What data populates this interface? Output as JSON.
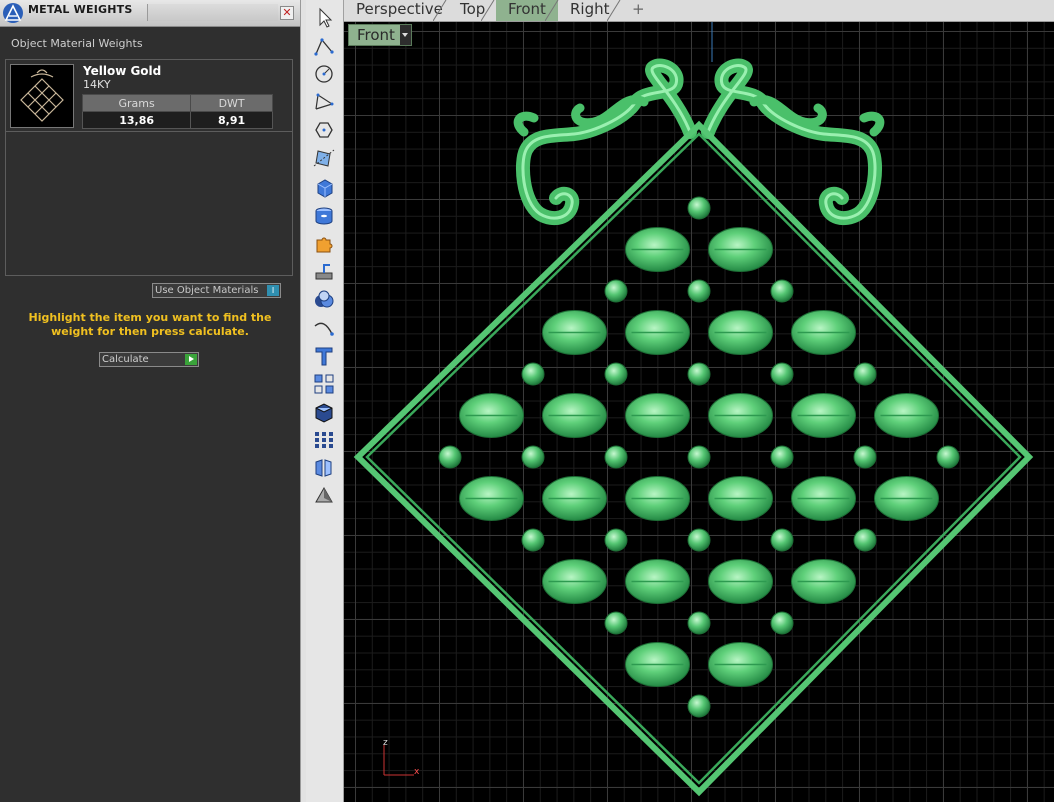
{
  "panel": {
    "title": "METAL WEIGHTS",
    "close_glyph": "✕",
    "section_title": "Object Material Weights",
    "material": {
      "name": "Yellow Gold",
      "karat": "14KY",
      "columns": [
        "Grams",
        "DWT"
      ],
      "values": [
        "13,86",
        "8,91"
      ]
    },
    "use_object_materials": {
      "label": "Use Object Materials",
      "toggle_glyph": "I"
    },
    "instructions": "Highlight the item you want to find the weight for then press calculate.",
    "calculate_label": "Calculate"
  },
  "toolbar": {
    "icons": [
      "select-arrow-icon",
      "polyline-icon",
      "circle-icon",
      "curve-icon",
      "polygon-icon",
      "transform-icon",
      "box-icon",
      "cylinder-icon",
      "puzzle-icon",
      "extrude-icon",
      "boolean-icon",
      "rail-curve-icon",
      "text-tool-icon",
      "array-icon",
      "solid-tool-icon",
      "grid-array-icon",
      "mirror-icon",
      "render-icon"
    ]
  },
  "viewport": {
    "tabs": [
      "Perspective",
      "Top",
      "Front",
      "Right"
    ],
    "active_tab": "Front",
    "add_tab_glyph": "+",
    "view_label": "Front",
    "axis_labels": {
      "z": "z",
      "x": "x"
    }
  },
  "colors": {
    "model_green": "#5fd07a",
    "tab_active": "#8fb28f",
    "instructions": "#f0c020"
  }
}
